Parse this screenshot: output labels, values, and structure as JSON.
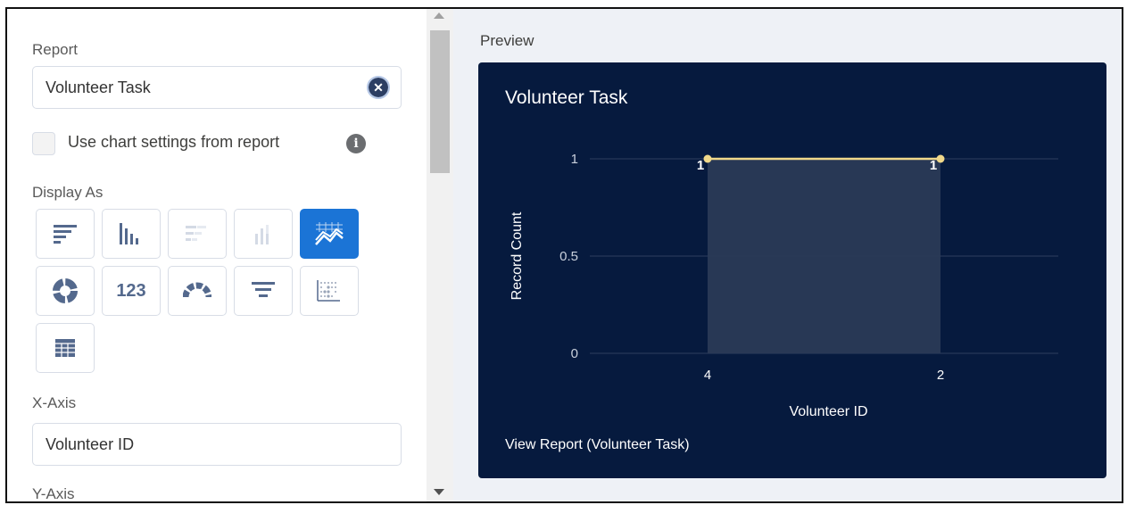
{
  "left_panel": {
    "report_label": "Report",
    "report_value": "Volunteer Task",
    "clear_symbol": "⊗",
    "use_chart_settings_label": "Use chart settings from report",
    "info_symbol": "i",
    "display_as_label": "Display As",
    "chart_types": [
      {
        "name": "horizontal-bar",
        "active": false
      },
      {
        "name": "vertical-bar",
        "active": false
      },
      {
        "name": "stacked-horizontal-bar",
        "active": false
      },
      {
        "name": "stacked-vertical-bar",
        "active": false
      },
      {
        "name": "line",
        "active": true
      },
      {
        "name": "donut",
        "active": false
      },
      {
        "name": "metric",
        "active": false,
        "text": "123"
      },
      {
        "name": "gauge",
        "active": false
      },
      {
        "name": "funnel",
        "active": false
      },
      {
        "name": "scatter",
        "active": false
      },
      {
        "name": "table",
        "active": false
      }
    ],
    "x_axis_label": "X-Axis",
    "x_axis_value": "Volunteer ID",
    "y_axis_label": "Y-Axis"
  },
  "preview": {
    "label": "Preview",
    "title": "Volunteer Task",
    "view_report_link": "View Report (Volunteer Task)"
  },
  "colors": {
    "active_tile": "#1b74d6",
    "card_bg": "#061a3e",
    "line": "#f0d88a",
    "area": "#2a3a56"
  },
  "chart_data": {
    "type": "line",
    "title": "Volunteer Task",
    "xlabel": "Volunteer ID",
    "ylabel": "Record Count",
    "categories": [
      "4",
      "2"
    ],
    "values": [
      1,
      1
    ],
    "data_labels": [
      "1",
      "1"
    ],
    "y_ticks": [
      "0",
      "0.5",
      "1"
    ],
    "ylim": [
      0,
      1
    ],
    "grid": true
  }
}
